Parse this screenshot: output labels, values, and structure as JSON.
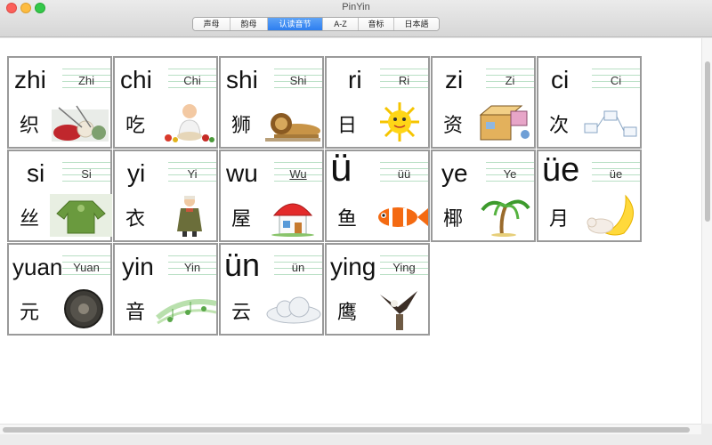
{
  "window": {
    "title": "PinYin"
  },
  "tabs": [
    {
      "label": "声母"
    },
    {
      "label": "韵母"
    },
    {
      "label": "认读音节"
    },
    {
      "label": "A-Z"
    },
    {
      "label": "音标"
    },
    {
      "label": "日本語"
    }
  ],
  "cards": [
    {
      "big": "zhi",
      "small": "Zhi",
      "han": "织",
      "icon": "knitting-yarn-icon"
    },
    {
      "big": "chi",
      "small": "Chi",
      "han": "吃",
      "icon": "baby-eating-icon"
    },
    {
      "big": "shi",
      "small": "Shi",
      "han": "狮",
      "icon": "lion-icon"
    },
    {
      "big": "ri",
      "small": "Ri",
      "han": "日",
      "icon": "sun-icon"
    },
    {
      "big": "zi",
      "small": "Zi",
      "han": "资",
      "icon": "toolbox-icon"
    },
    {
      "big": "ci",
      "small": "Ci",
      "han": "次",
      "icon": "steps-icon"
    },
    {
      "big": "si",
      "small": "Si",
      "han": "丝",
      "icon": "green-sweater-icon"
    },
    {
      "big": "yi",
      "small": "Yi",
      "han": "衣",
      "icon": "girl-coat-icon"
    },
    {
      "big": "wu",
      "small": "Wu",
      "han": "屋",
      "icon": "house-icon"
    },
    {
      "big": "ü",
      "small": "üü",
      "han": "鱼",
      "icon": "clownfish-icon"
    },
    {
      "big": "ye",
      "small": "Ye",
      "han": "椰",
      "icon": "palm-tree-icon"
    },
    {
      "big": "üe",
      "small": "üe",
      "han": "月",
      "icon": "moon-icon"
    },
    {
      "big": "yuan",
      "small": "Yuan",
      "han": "元",
      "icon": "coin-icon"
    },
    {
      "big": "yin",
      "small": "Yin",
      "han": "音",
      "icon": "music-notes-icon"
    },
    {
      "big": "ün",
      "small": "ün",
      "han": "云",
      "icon": "cloud-icon"
    },
    {
      "big": "ying",
      "small": "Ying",
      "han": "鹰",
      "icon": "eagle-icon"
    }
  ],
  "colors": {
    "accent": "#2d7ef0",
    "card_border": "#9a9a9a",
    "guide_lines": "#b8dfc4"
  }
}
